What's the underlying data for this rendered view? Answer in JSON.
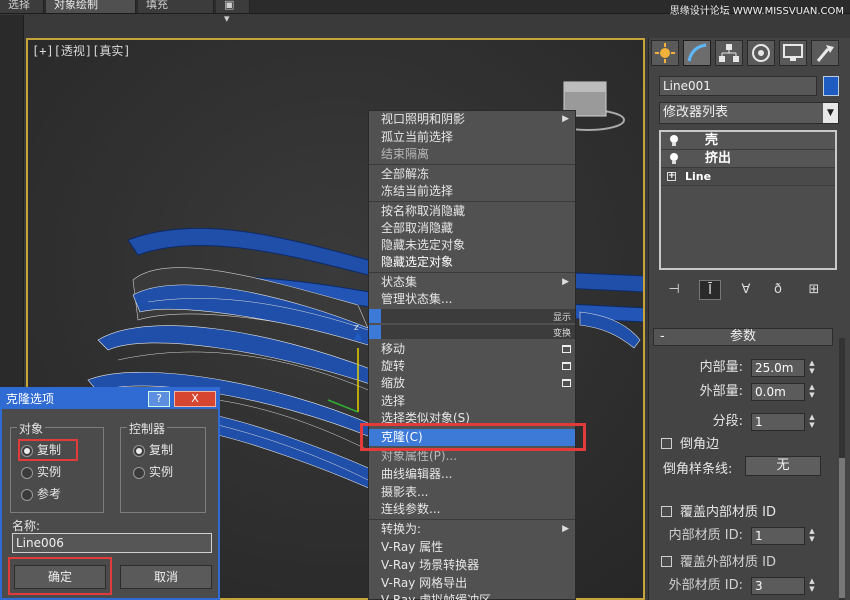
{
  "top_tabs": [
    "选择",
    "对象绘制",
    "填充"
  ],
  "top_watermark": "思缘设计论坛 WWW.MISSVUAN.COM",
  "viewport": {
    "label": "[+][透视][真实]",
    "gizmo_label": "z"
  },
  "context_menu": {
    "items_group1": [
      {
        "label": "视口照明和阴影",
        "submenu": true
      },
      {
        "label": "孤立当前选择"
      },
      {
        "label": "结束隔离",
        "dim": true
      },
      {
        "label": "全部解冻"
      },
      {
        "label": "冻结当前选择"
      }
    ],
    "items_group2": [
      {
        "label": "按名称取消隐藏"
      },
      {
        "label": "全部取消隐藏"
      },
      {
        "label": "隐藏未选定对象"
      },
      {
        "label": "隐藏选定对象",
        "bold": true
      }
    ],
    "items_group3": [
      {
        "label": "状态集",
        "submenu": true
      },
      {
        "label": "管理状态集..."
      }
    ],
    "header_display": "显示",
    "header_transform": "变换",
    "items_group4": [
      {
        "label": "移动",
        "win": true
      },
      {
        "label": "旋转",
        "win": true
      },
      {
        "label": "缩放",
        "win": true
      },
      {
        "label": "选择"
      },
      {
        "label": "选择类似对象(S)"
      },
      {
        "label": "克隆(C)",
        "selected": true
      },
      {
        "label": "对象属性(P)..."
      },
      {
        "label": "曲线编辑器..."
      },
      {
        "label": "摄影表..."
      },
      {
        "label": "连线参数..."
      }
    ],
    "items_group5": [
      {
        "label": "转换为:",
        "submenu": true
      },
      {
        "label": "V-Ray 属性"
      },
      {
        "label": "V-Ray 场景转换器"
      },
      {
        "label": "V-Ray 网格导出"
      },
      {
        "label": "V-Ray 虚拟帧缓冲区"
      }
    ]
  },
  "clone_dialog": {
    "title": "克隆选项",
    "help": "?",
    "close": "X",
    "object_group_title": "对象",
    "object_options": [
      "复制",
      "实例",
      "参考"
    ],
    "object_selected": "复制",
    "controller_group_title": "控制器",
    "controller_options": [
      "复制",
      "实例"
    ],
    "name_label": "名称:",
    "name_value": "Line006",
    "ok": "确定",
    "cancel": "取消"
  },
  "command_panel": {
    "object_name": "Line001",
    "object_color": "#1f5cc2",
    "modifier_list": "修改器列表",
    "stack": [
      "壳",
      "挤出",
      "Line"
    ],
    "params_title": "参数",
    "inner_amount_label": "内部量:",
    "inner_amount_value": "25.0m",
    "outer_amount_label": "外部量:",
    "outer_amount_value": "0.0m",
    "segments_label": "分段:",
    "segments_value": "1",
    "bevel_edges_label": "倒角边",
    "bevel_spline_label": "倒角样条线:",
    "bevel_spline_value": "无",
    "override_inner_label": "覆盖内部材质 ID",
    "inner_mat_label": "内部材质 ID:",
    "inner_mat_value": "1",
    "override_outer_label": "覆盖外部材质 ID",
    "outer_mat_label": "外部材质 ID:",
    "outer_mat_value": "3"
  },
  "colors": {
    "accent_blue": "#3d7ad8",
    "dialog_blue": "#2f6bd3",
    "highlight_red": "#e13b3b",
    "viewport_border": "#c7a43b",
    "object_blue": "#1f4fa8"
  }
}
